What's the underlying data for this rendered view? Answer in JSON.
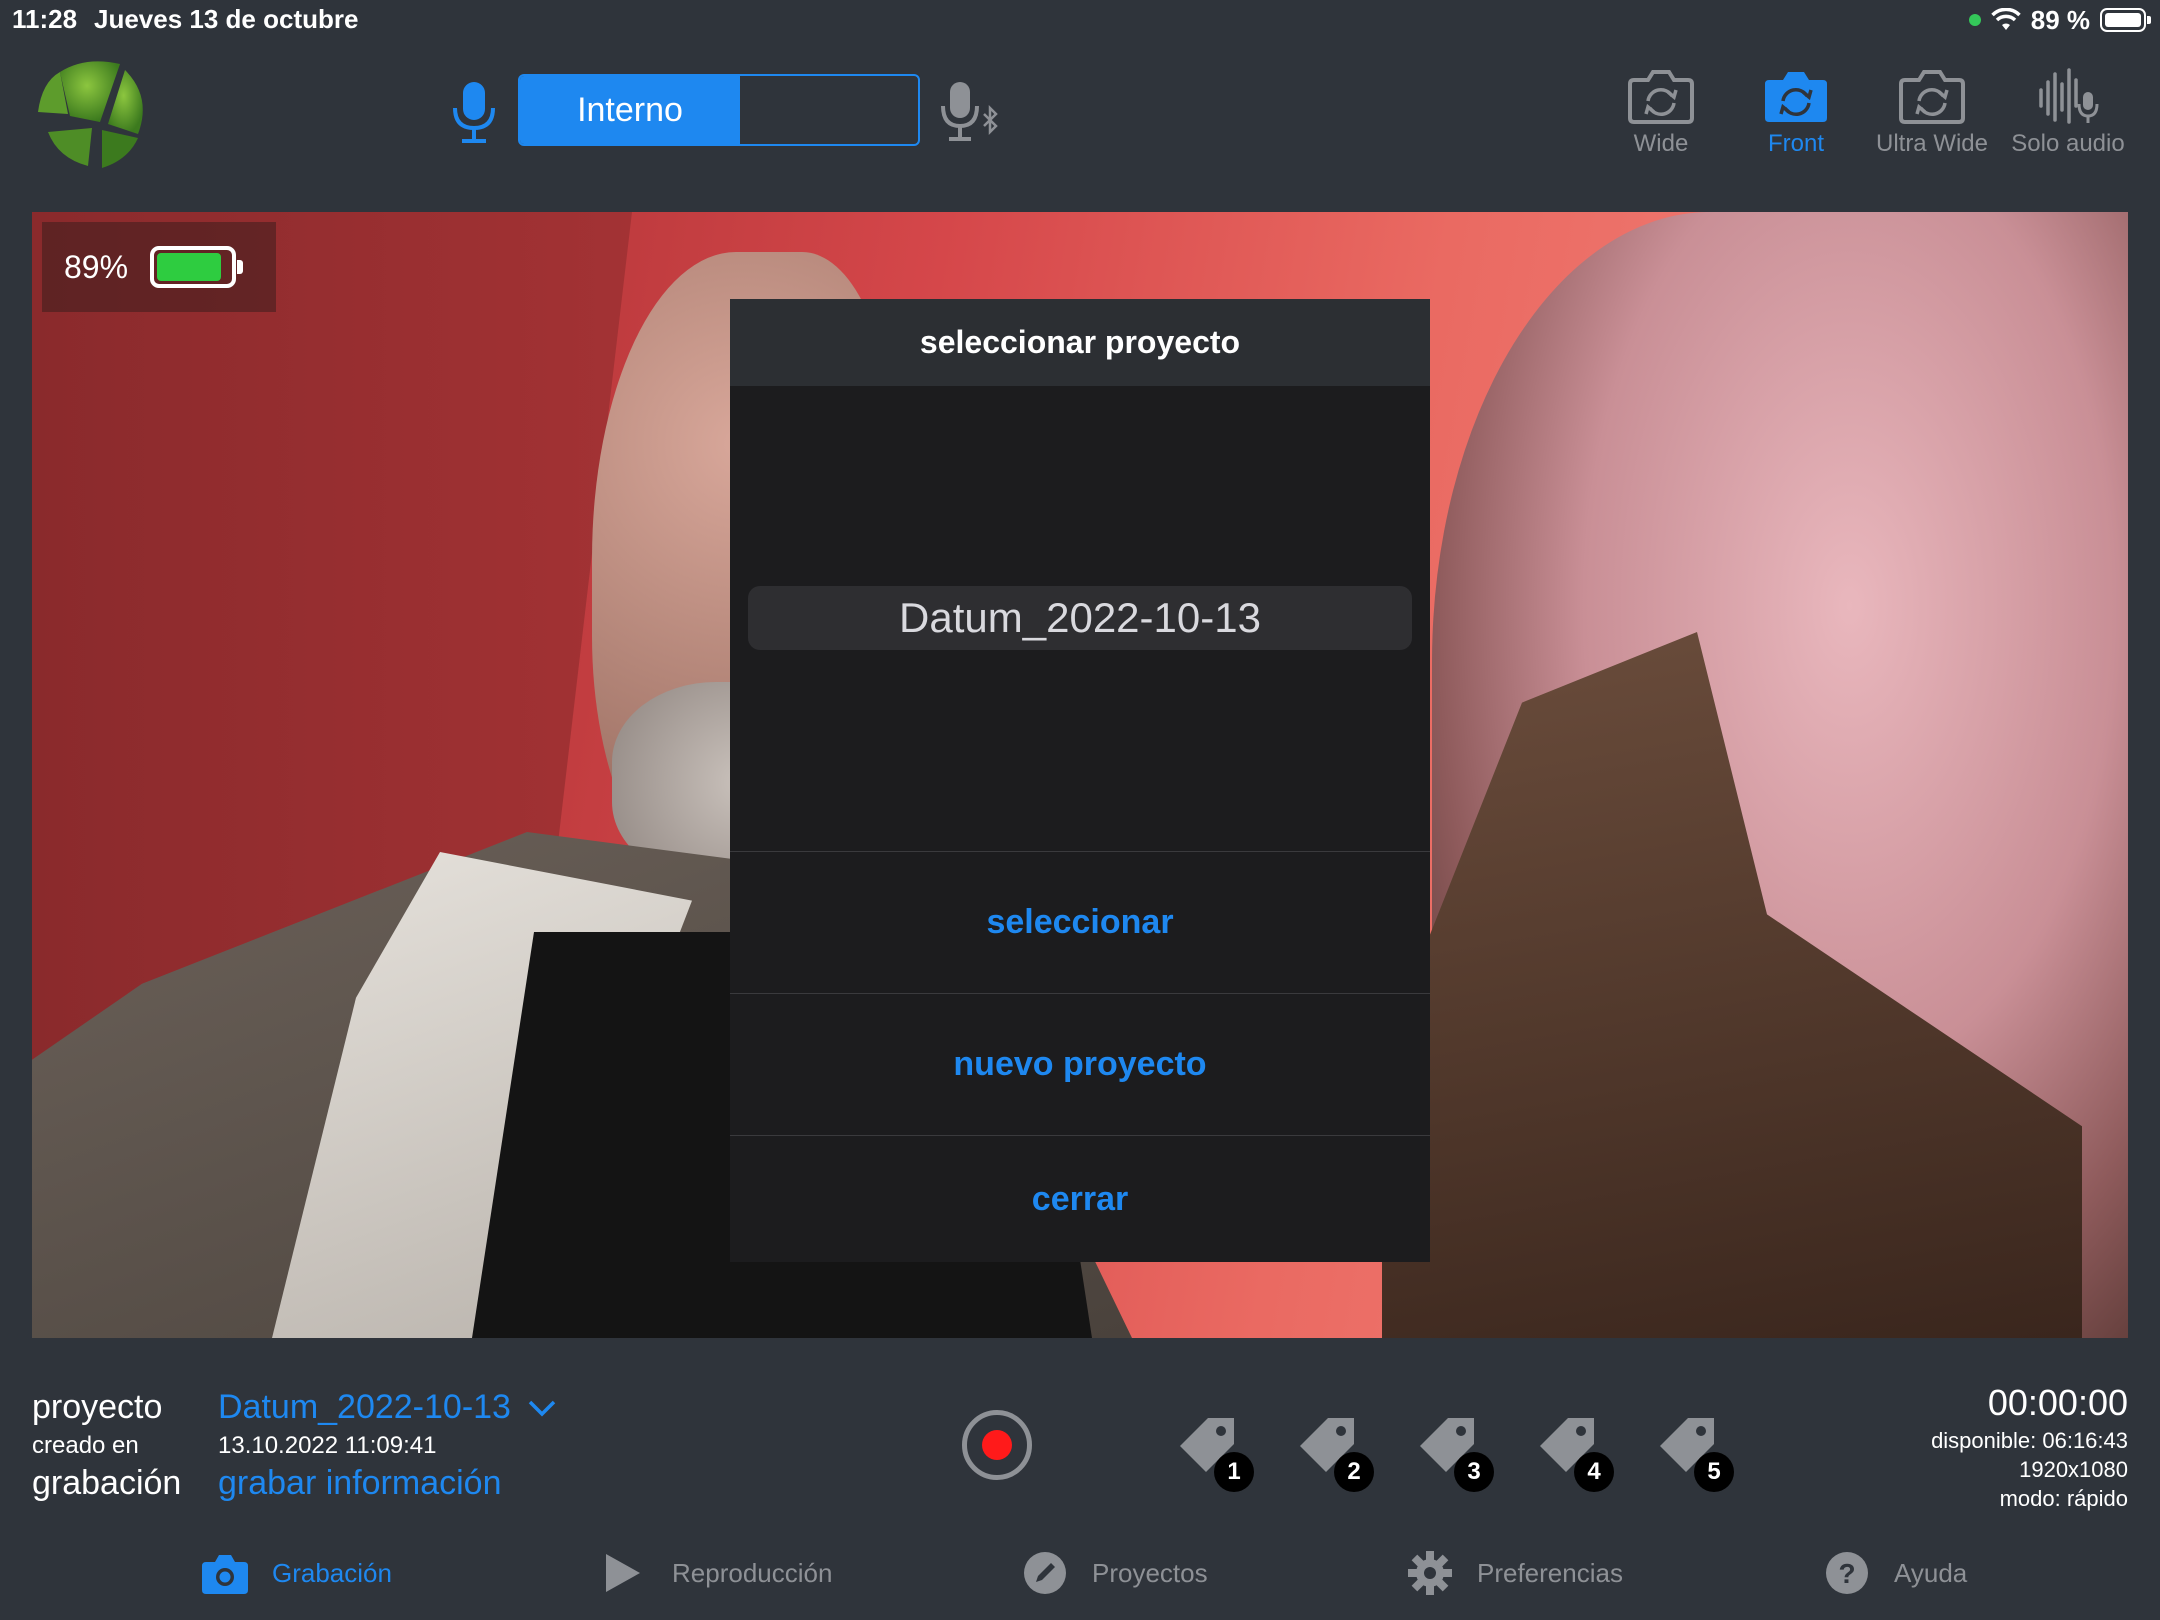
{
  "status_bar": {
    "time": "11:28",
    "date": "Jueves 13 de octubre",
    "battery_text": "89 %"
  },
  "audio": {
    "segment_active_label": "Interno"
  },
  "cameras": [
    {
      "label": "Wide",
      "icon": "camera-rotate-icon",
      "active": false
    },
    {
      "label": "Front",
      "icon": "camera-rotate-icon",
      "active": true
    },
    {
      "label": "Ultra Wide",
      "icon": "camera-rotate-icon",
      "active": false
    },
    {
      "label": "Solo audio",
      "icon": "waveform-mic-icon",
      "active": false
    }
  ],
  "preview": {
    "battery_percent_text": "89%",
    "battery_level": 0.89
  },
  "modal": {
    "title": "seleccionar proyecto",
    "picker_selected": "Datum_2022-10-13",
    "buttons": [
      "seleccionar",
      "nuevo proyecto",
      "cerrar"
    ]
  },
  "project_info": {
    "project_label": "proyecto",
    "created_label": "creado en",
    "recording_label": "grabación",
    "project_name": "Datum_2022-10-13",
    "created_at": "13.10.2022 11:09:41",
    "record_info_link": "grabar información"
  },
  "tags": [
    "1",
    "2",
    "3",
    "4",
    "5"
  ],
  "recording_stats": {
    "timer": "00:00:00",
    "available": "disponible: 06:16:43",
    "resolution": "1920x1080",
    "mode": "modo: rápido"
  },
  "tabs": [
    {
      "label": "Grabación",
      "icon": "camera-icon",
      "active": true
    },
    {
      "label": "Reproducción",
      "icon": "play-icon",
      "active": false
    },
    {
      "label": "Proyectos",
      "icon": "pencil-circle-icon",
      "active": false
    },
    {
      "label": "Preferencias",
      "icon": "gear-icon",
      "active": false
    },
    {
      "label": "Ayuda",
      "icon": "question-circle-icon",
      "active": false
    }
  ],
  "colors": {
    "accent": "#1e88f0",
    "background": "#2f343b",
    "record": "#ff1a1a",
    "battery_green": "#2ecc40"
  }
}
